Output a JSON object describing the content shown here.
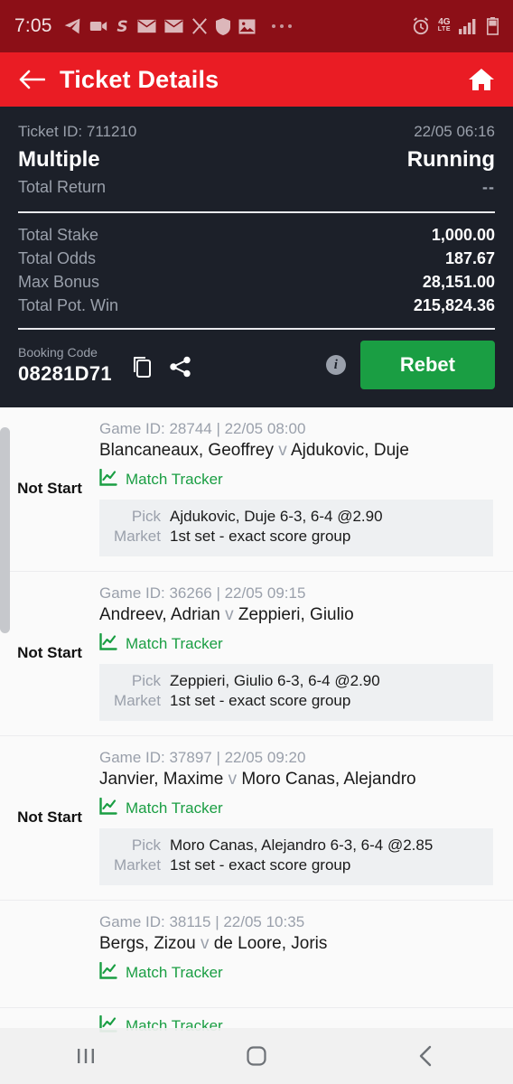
{
  "statusbar": {
    "time": "7:05",
    "icons": [
      "telegram-icon",
      "video-camera-icon",
      "dollar-s-icon",
      "mail-icon",
      "mail-icon",
      "x-twitter-icon",
      "shield-icon",
      "photo-icon",
      "more-dots-icon",
      "alarm-clock-icon"
    ],
    "network_main": "4G",
    "network_sub": "LTE"
  },
  "header": {
    "title": "Ticket Details",
    "back_icon": "arrow-left-icon",
    "home_icon": "home-icon"
  },
  "summary": {
    "ticket_id": "Ticket ID: 711210",
    "timestamp": "22/05 06:16",
    "bet_type": "Multiple",
    "status": "Running",
    "total_return_label": "Total Return",
    "total_return_value": "--",
    "stats": [
      {
        "label": "Total Stake",
        "value": "1,000.00"
      },
      {
        "label": "Total Odds",
        "value": "187.67"
      },
      {
        "label": "Max Bonus",
        "value": "28,151.00"
      },
      {
        "label": "Total Pot. Win",
        "value": "215,824.36"
      }
    ],
    "booking_label": "Booking Code",
    "booking_code": "08281D71",
    "copy_icon": "copy-icon",
    "share_icon": "share-icon",
    "info_icon": "info-icon",
    "info_glyph": "i",
    "rebet_label": "Rebet",
    "accent_green": "#1a9e43",
    "panel_bg": "#1c2029",
    "header_red": "#ea1c24"
  },
  "matches": [
    {
      "status": "Not Start",
      "meta": "Game ID: 28744 | 22/05 08:00",
      "player_home": "Blancaneaux, Geoffrey",
      "vs": "v",
      "player_away": "Ajdukovic, Duje",
      "tracker_label": "Match Tracker",
      "tracker_icon": "line-chart-icon",
      "pick_key": "Pick",
      "pick_value": "Ajdukovic, Duje 6-3, 6-4 @2.90",
      "market_key": "Market",
      "market_value": "1st set - exact score group"
    },
    {
      "status": "Not Start",
      "meta": "Game ID: 36266 | 22/05 09:15",
      "player_home": "Andreev, Adrian",
      "vs": "v",
      "player_away": "Zeppieri, Giulio",
      "tracker_label": "Match Tracker",
      "tracker_icon": "line-chart-icon",
      "pick_key": "Pick",
      "pick_value": "Zeppieri, Giulio 6-3, 6-4 @2.90",
      "market_key": "Market",
      "market_value": "1st set - exact score group"
    },
    {
      "status": "Not Start",
      "meta": "Game ID: 37897 | 22/05 09:20",
      "player_home": "Janvier, Maxime",
      "vs": "v",
      "player_away": "Moro Canas, Alejandro",
      "tracker_label": "Match Tracker",
      "tracker_icon": "line-chart-icon",
      "pick_key": "Pick",
      "pick_value": "Moro Canas, Alejandro 6-3, 6-4 @2.85",
      "market_key": "Market",
      "market_value": "1st set - exact score group"
    },
    {
      "status": "",
      "meta": "Game ID: 38115 | 22/05 10:35",
      "player_home": "Bergs, Zizou",
      "vs": "v",
      "player_away": "de Loore, Joris",
      "tracker_label": "Match Tracker",
      "tracker_icon": "line-chart-icon",
      "pick_key": "",
      "pick_value": "",
      "market_key": "",
      "market_value": ""
    }
  ],
  "partial_below_nav": {
    "tracker_label": "Match Tracker"
  },
  "navbar": {
    "recents_icon": "recents-icon",
    "home_icon": "home-square-icon",
    "back_icon": "chevron-left-icon"
  }
}
